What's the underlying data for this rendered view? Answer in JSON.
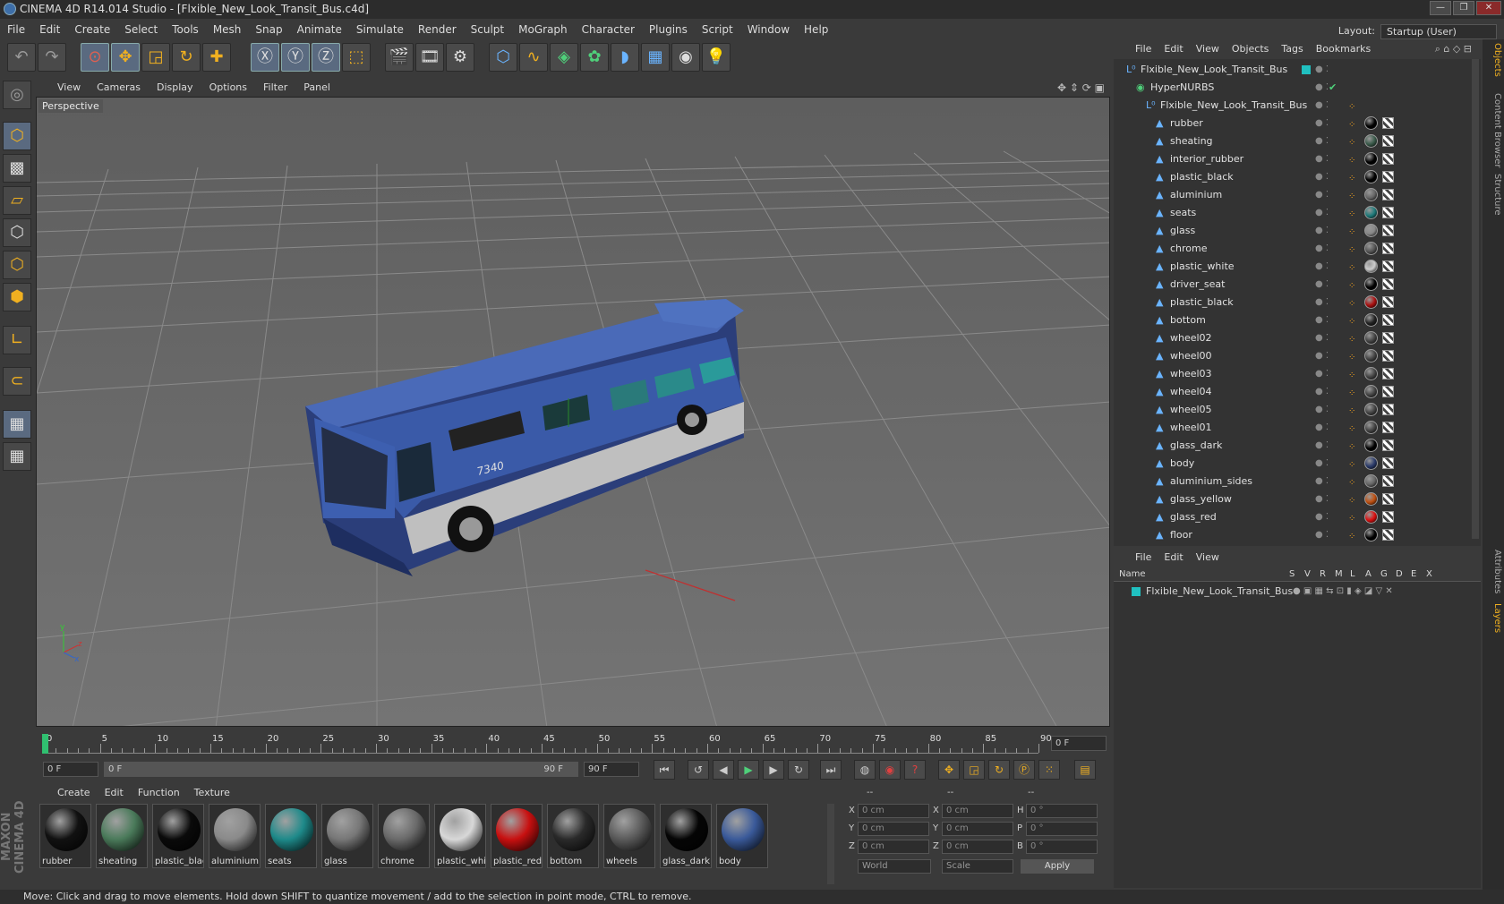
{
  "title": "CINEMA 4D R14.014 Studio - [Flxible_New_Look_Transit_Bus.c4d]",
  "window_buttons": [
    "—",
    "❐",
    "✕"
  ],
  "menu": [
    "File",
    "Edit",
    "Create",
    "Select",
    "Tools",
    "Mesh",
    "Snap",
    "Animate",
    "Simulate",
    "Render",
    "Sculpt",
    "MoGraph",
    "Character",
    "Plugins",
    "Script",
    "Window",
    "Help"
  ],
  "layout": {
    "label": "Layout:",
    "value": "Startup (User)"
  },
  "viewport": {
    "menu": [
      "View",
      "Cameras",
      "Display",
      "Options",
      "Filter",
      "Panel"
    ],
    "label": "Perspective",
    "bus_number": "7340"
  },
  "timeline": {
    "ticks": [
      "0",
      "5",
      "10",
      "15",
      "20",
      "25",
      "30",
      "35",
      "40",
      "45",
      "50",
      "55",
      "60",
      "65",
      "70",
      "75",
      "80",
      "85",
      "90"
    ],
    "current_frame": "0 F",
    "start": "0 F",
    "range_start": "0 F",
    "range_end": "90 F",
    "end": "90 F"
  },
  "materials": {
    "menu": [
      "Create",
      "Edit",
      "Function",
      "Texture"
    ],
    "items": [
      {
        "name": "rubber",
        "color": "#111111"
      },
      {
        "name": "sheating",
        "color": "#4a7a5a"
      },
      {
        "name": "plastic_blac",
        "color": "#0a0a0a"
      },
      {
        "name": "aluminium",
        "color": "#8a8a8a"
      },
      {
        "name": "seats",
        "color": "#1e8a8a"
      },
      {
        "name": "glass",
        "color": "#777777"
      },
      {
        "name": "chrome",
        "color": "#6a6a6a"
      },
      {
        "name": "plastic_whi",
        "color": "#d8d8d8"
      },
      {
        "name": "plastic_red",
        "color": "#c81010"
      },
      {
        "name": "bottom",
        "color": "#2a2a2a"
      },
      {
        "name": "wheels",
        "color": "#5a5a5a"
      },
      {
        "name": "glass_dark",
        "color": "#050505"
      },
      {
        "name": "body",
        "color": "#3a5a9a"
      }
    ]
  },
  "coordinates": {
    "headers": [
      "--",
      "--",
      "--"
    ],
    "rows": [
      {
        "a": "X",
        "av": "0 cm",
        "b": "X",
        "bv": "0 cm",
        "c": "H",
        "cv": "0 °"
      },
      {
        "a": "Y",
        "av": "0 cm",
        "b": "Y",
        "bv": "0 cm",
        "c": "P",
        "cv": "0 °"
      },
      {
        "a": "Z",
        "av": "0 cm",
        "b": "Z",
        "bv": "0 cm",
        "c": "B",
        "cv": "0 °"
      }
    ],
    "mode1": "World",
    "mode2": "Scale",
    "apply": "Apply"
  },
  "objects": {
    "menu": [
      "File",
      "Edit",
      "View",
      "Objects",
      "Tags",
      "Bookmarks"
    ],
    "tree": [
      {
        "name": "Flxible_New_Look_Transit_Bus",
        "indent": 0,
        "kind": "root"
      },
      {
        "name": "HyperNURBS",
        "indent": 1,
        "kind": "nurbs"
      },
      {
        "name": "Flxible_New_Look_Transit_Bus",
        "indent": 2,
        "kind": "null"
      },
      {
        "name": "rubber",
        "indent": 3,
        "kind": "poly",
        "mat": "#000000"
      },
      {
        "name": "sheating",
        "indent": 3,
        "kind": "poly",
        "mat": "#3a5a4a"
      },
      {
        "name": "interior_rubber",
        "indent": 3,
        "kind": "poly",
        "mat": "#000000"
      },
      {
        "name": "plastic_black",
        "indent": 3,
        "kind": "poly",
        "mat": "#000000"
      },
      {
        "name": "aluminium",
        "indent": 3,
        "kind": "poly",
        "mat": "#666666"
      },
      {
        "name": "seats",
        "indent": 3,
        "kind": "poly",
        "mat": "#1e7a7a"
      },
      {
        "name": "glass",
        "indent": 3,
        "kind": "poly",
        "mat": "#888888"
      },
      {
        "name": "chrome",
        "indent": 3,
        "kind": "poly",
        "mat": "#555555"
      },
      {
        "name": "plastic_white",
        "indent": 3,
        "kind": "poly",
        "mat": "#cccccc"
      },
      {
        "name": "driver_seat",
        "indent": 3,
        "kind": "poly",
        "mat": "#000000"
      },
      {
        "name": "plastic_black",
        "indent": 3,
        "kind": "poly",
        "mat": "#aa1010"
      },
      {
        "name": "bottom",
        "indent": 3,
        "kind": "poly",
        "mat": "#222222"
      },
      {
        "name": "wheel02",
        "indent": 3,
        "kind": "poly",
        "mat": "#444444"
      },
      {
        "name": "wheel00",
        "indent": 3,
        "kind": "poly",
        "mat": "#444444"
      },
      {
        "name": "wheel03",
        "indent": 3,
        "kind": "poly",
        "mat": "#444444"
      },
      {
        "name": "wheel04",
        "indent": 3,
        "kind": "poly",
        "mat": "#444444"
      },
      {
        "name": "wheel05",
        "indent": 3,
        "kind": "poly",
        "mat": "#444444"
      },
      {
        "name": "wheel01",
        "indent": 3,
        "kind": "poly",
        "mat": "#444444"
      },
      {
        "name": "glass_dark",
        "indent": 3,
        "kind": "poly",
        "mat": "#000000"
      },
      {
        "name": "body",
        "indent": 3,
        "kind": "poly",
        "mat": "#2a3a6a"
      },
      {
        "name": "aluminium_sides",
        "indent": 3,
        "kind": "poly",
        "mat": "#666666"
      },
      {
        "name": "glass_yellow",
        "indent": 3,
        "kind": "poly",
        "mat": "#c05010"
      },
      {
        "name": "glass_red",
        "indent": 3,
        "kind": "poly",
        "mat": "#dd1010"
      },
      {
        "name": "floor",
        "indent": 3,
        "kind": "poly",
        "mat": "#000000"
      }
    ]
  },
  "layers": {
    "menu": [
      "File",
      "Edit",
      "View"
    ],
    "columns": [
      "Name",
      "S",
      "V",
      "R",
      "M",
      "L",
      "A",
      "G",
      "D",
      "E",
      "X"
    ],
    "rows": [
      {
        "name": "Flxible_New_Look_Transit_Bus"
      }
    ]
  },
  "right_tabs": [
    "Objects",
    "Content Browser",
    "Structure",
    "Attributes",
    "Layers"
  ],
  "status": "Move: Click and drag to move elements. Hold down SHIFT to quantize movement / add to the selection in point mode, CTRL to remove.",
  "brand": "MAXON CINEMA 4D"
}
